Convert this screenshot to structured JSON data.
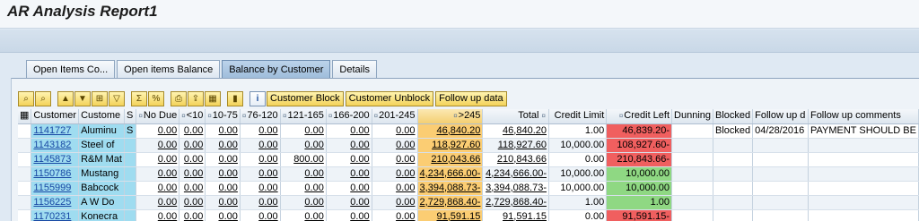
{
  "window": {
    "title": "AR Analysis Report1"
  },
  "tabs": [
    {
      "label": "Open Items Co...",
      "active": false
    },
    {
      "label": "Open items Balance",
      "active": false
    },
    {
      "label": "Balance by Customer",
      "active": true
    },
    {
      "label": "Details",
      "active": false
    }
  ],
  "toolbar": {
    "customer_block": "Customer Block",
    "customer_unblock": "Customer Unblock",
    "follow_up_data": "Follow up data"
  },
  "icons": {
    "find": "search-icon",
    "find_next": "find-next-icon",
    "sort_asc": "sort-ascending-icon",
    "sort_desc": "sort-descending-icon",
    "filter": "filter-icon",
    "total": "sum-icon",
    "subtotal": "subtotal-icon",
    "print": "print-icon",
    "export": "export-icon",
    "layout": "layout-icon",
    "graphic": "bar-chart-icon",
    "info": "info-icon"
  },
  "table": {
    "columns": [
      "Customer",
      "Custome",
      "S",
      "No Due",
      "<10",
      "10-75",
      "76-120",
      "121-165",
      "166-200",
      "201-245",
      ">245",
      "Total",
      "Credit Limit",
      "Credit Left",
      "Dunning",
      "Blocked",
      "Follow up d",
      "Follow up comments"
    ],
    "rows": [
      [
        "1141727",
        "Aluminu",
        "S",
        "0.00",
        "0.00",
        "0.00",
        "0.00",
        "0.00",
        "0.00",
        "0.00",
        "46,840.20",
        "46,840.20",
        "1.00",
        "46,839.20-",
        "",
        "Blocked",
        "04/28/2016",
        "PAYMENT SHOULD BE"
      ],
      [
        "1143182",
        "Steel of",
        "",
        "0.00",
        "0.00",
        "0.00",
        "0.00",
        "0.00",
        "0.00",
        "0.00",
        "118,927.60",
        "118,927.60",
        "10,000.00",
        "108,927.60-",
        "",
        "",
        "",
        ""
      ],
      [
        "1145873",
        "R&M Mat",
        "",
        "0.00",
        "0.00",
        "0.00",
        "0.00",
        "800.00",
        "0.00",
        "0.00",
        "210,043.66",
        "210,843.66",
        "0.00",
        "210,843.66-",
        "",
        "",
        "",
        ""
      ],
      [
        "1150786",
        "Mustang",
        "",
        "0.00",
        "0.00",
        "0.00",
        "0.00",
        "0.00",
        "0.00",
        "0.00",
        "4,234,666.00-",
        "4,234,666.00-",
        "10,000.00",
        "10,000.00",
        "",
        "",
        "",
        ""
      ],
      [
        "1155999",
        "Babcock",
        "",
        "0.00",
        "0.00",
        "0.00",
        "0.00",
        "0.00",
        "0.00",
        "0.00",
        "3,394,088.73-",
        "3,394,088.73-",
        "10,000.00",
        "10,000.00",
        "",
        "",
        "",
        ""
      ],
      [
        "1156225",
        "A W Do",
        "",
        "0.00",
        "0.00",
        "0.00",
        "0.00",
        "0.00",
        "0.00",
        "0.00",
        "2,729,868.40-",
        "2,729,868.40-",
        "1.00",
        "1.00",
        "",
        "",
        "",
        ""
      ],
      [
        "1170231",
        "Konecra",
        "",
        "0.00",
        "0.00",
        "0.00",
        "0.00",
        "0.00",
        "0.00",
        "0.00",
        "91,591.15",
        "91,591.15",
        "0.00",
        "91,591.15-",
        "",
        "",
        "",
        ""
      ]
    ],
    "credit_left_status": [
      "red",
      "red",
      "red",
      "green",
      "green",
      "green",
      "red"
    ]
  },
  "colors": {
    "customer_highlight": "#9fdcf0",
    "over_245": "#fbcd73",
    "negative": "#f05f5f",
    "positive": "#8fd883"
  }
}
